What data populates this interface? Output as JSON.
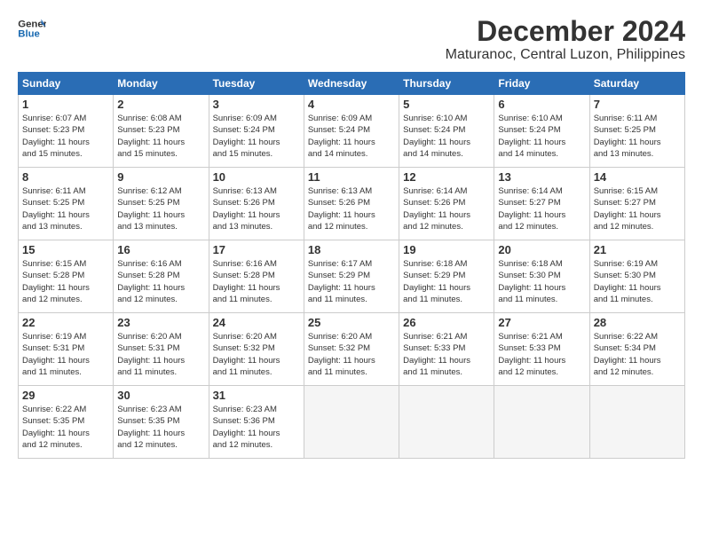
{
  "logo": {
    "line1": "General",
    "line2": "Blue"
  },
  "title": "December 2024",
  "location": "Maturanoc, Central Luzon, Philippines",
  "headers": [
    "Sunday",
    "Monday",
    "Tuesday",
    "Wednesday",
    "Thursday",
    "Friday",
    "Saturday"
  ],
  "weeks": [
    [
      {
        "day": "1",
        "sunrise": "6:07 AM",
        "sunset": "5:23 PM",
        "daylight": "11 hours and 15 minutes."
      },
      {
        "day": "2",
        "sunrise": "6:08 AM",
        "sunset": "5:23 PM",
        "daylight": "11 hours and 15 minutes."
      },
      {
        "day": "3",
        "sunrise": "6:09 AM",
        "sunset": "5:24 PM",
        "daylight": "11 hours and 15 minutes."
      },
      {
        "day": "4",
        "sunrise": "6:09 AM",
        "sunset": "5:24 PM",
        "daylight": "11 hours and 14 minutes."
      },
      {
        "day": "5",
        "sunrise": "6:10 AM",
        "sunset": "5:24 PM",
        "daylight": "11 hours and 14 minutes."
      },
      {
        "day": "6",
        "sunrise": "6:10 AM",
        "sunset": "5:24 PM",
        "daylight": "11 hours and 14 minutes."
      },
      {
        "day": "7",
        "sunrise": "6:11 AM",
        "sunset": "5:25 PM",
        "daylight": "11 hours and 13 minutes."
      }
    ],
    [
      {
        "day": "8",
        "sunrise": "6:11 AM",
        "sunset": "5:25 PM",
        "daylight": "11 hours and 13 minutes."
      },
      {
        "day": "9",
        "sunrise": "6:12 AM",
        "sunset": "5:25 PM",
        "daylight": "11 hours and 13 minutes."
      },
      {
        "day": "10",
        "sunrise": "6:13 AM",
        "sunset": "5:26 PM",
        "daylight": "11 hours and 13 minutes."
      },
      {
        "day": "11",
        "sunrise": "6:13 AM",
        "sunset": "5:26 PM",
        "daylight": "11 hours and 12 minutes."
      },
      {
        "day": "12",
        "sunrise": "6:14 AM",
        "sunset": "5:26 PM",
        "daylight": "11 hours and 12 minutes."
      },
      {
        "day": "13",
        "sunrise": "6:14 AM",
        "sunset": "5:27 PM",
        "daylight": "11 hours and 12 minutes."
      },
      {
        "day": "14",
        "sunrise": "6:15 AM",
        "sunset": "5:27 PM",
        "daylight": "11 hours and 12 minutes."
      }
    ],
    [
      {
        "day": "15",
        "sunrise": "6:15 AM",
        "sunset": "5:28 PM",
        "daylight": "11 hours and 12 minutes."
      },
      {
        "day": "16",
        "sunrise": "6:16 AM",
        "sunset": "5:28 PM",
        "daylight": "11 hours and 12 minutes."
      },
      {
        "day": "17",
        "sunrise": "6:16 AM",
        "sunset": "5:28 PM",
        "daylight": "11 hours and 11 minutes."
      },
      {
        "day": "18",
        "sunrise": "6:17 AM",
        "sunset": "5:29 PM",
        "daylight": "11 hours and 11 minutes."
      },
      {
        "day": "19",
        "sunrise": "6:18 AM",
        "sunset": "5:29 PM",
        "daylight": "11 hours and 11 minutes."
      },
      {
        "day": "20",
        "sunrise": "6:18 AM",
        "sunset": "5:30 PM",
        "daylight": "11 hours and 11 minutes."
      },
      {
        "day": "21",
        "sunrise": "6:19 AM",
        "sunset": "5:30 PM",
        "daylight": "11 hours and 11 minutes."
      }
    ],
    [
      {
        "day": "22",
        "sunrise": "6:19 AM",
        "sunset": "5:31 PM",
        "daylight": "11 hours and 11 minutes."
      },
      {
        "day": "23",
        "sunrise": "6:20 AM",
        "sunset": "5:31 PM",
        "daylight": "11 hours and 11 minutes."
      },
      {
        "day": "24",
        "sunrise": "6:20 AM",
        "sunset": "5:32 PM",
        "daylight": "11 hours and 11 minutes."
      },
      {
        "day": "25",
        "sunrise": "6:20 AM",
        "sunset": "5:32 PM",
        "daylight": "11 hours and 11 minutes."
      },
      {
        "day": "26",
        "sunrise": "6:21 AM",
        "sunset": "5:33 PM",
        "daylight": "11 hours and 11 minutes."
      },
      {
        "day": "27",
        "sunrise": "6:21 AM",
        "sunset": "5:33 PM",
        "daylight": "11 hours and 12 minutes."
      },
      {
        "day": "28",
        "sunrise": "6:22 AM",
        "sunset": "5:34 PM",
        "daylight": "11 hours and 12 minutes."
      }
    ],
    [
      {
        "day": "29",
        "sunrise": "6:22 AM",
        "sunset": "5:35 PM",
        "daylight": "11 hours and 12 minutes."
      },
      {
        "day": "30",
        "sunrise": "6:23 AM",
        "sunset": "5:35 PM",
        "daylight": "11 hours and 12 minutes."
      },
      {
        "day": "31",
        "sunrise": "6:23 AM",
        "sunset": "5:36 PM",
        "daylight": "11 hours and 12 minutes."
      },
      null,
      null,
      null,
      null
    ]
  ]
}
